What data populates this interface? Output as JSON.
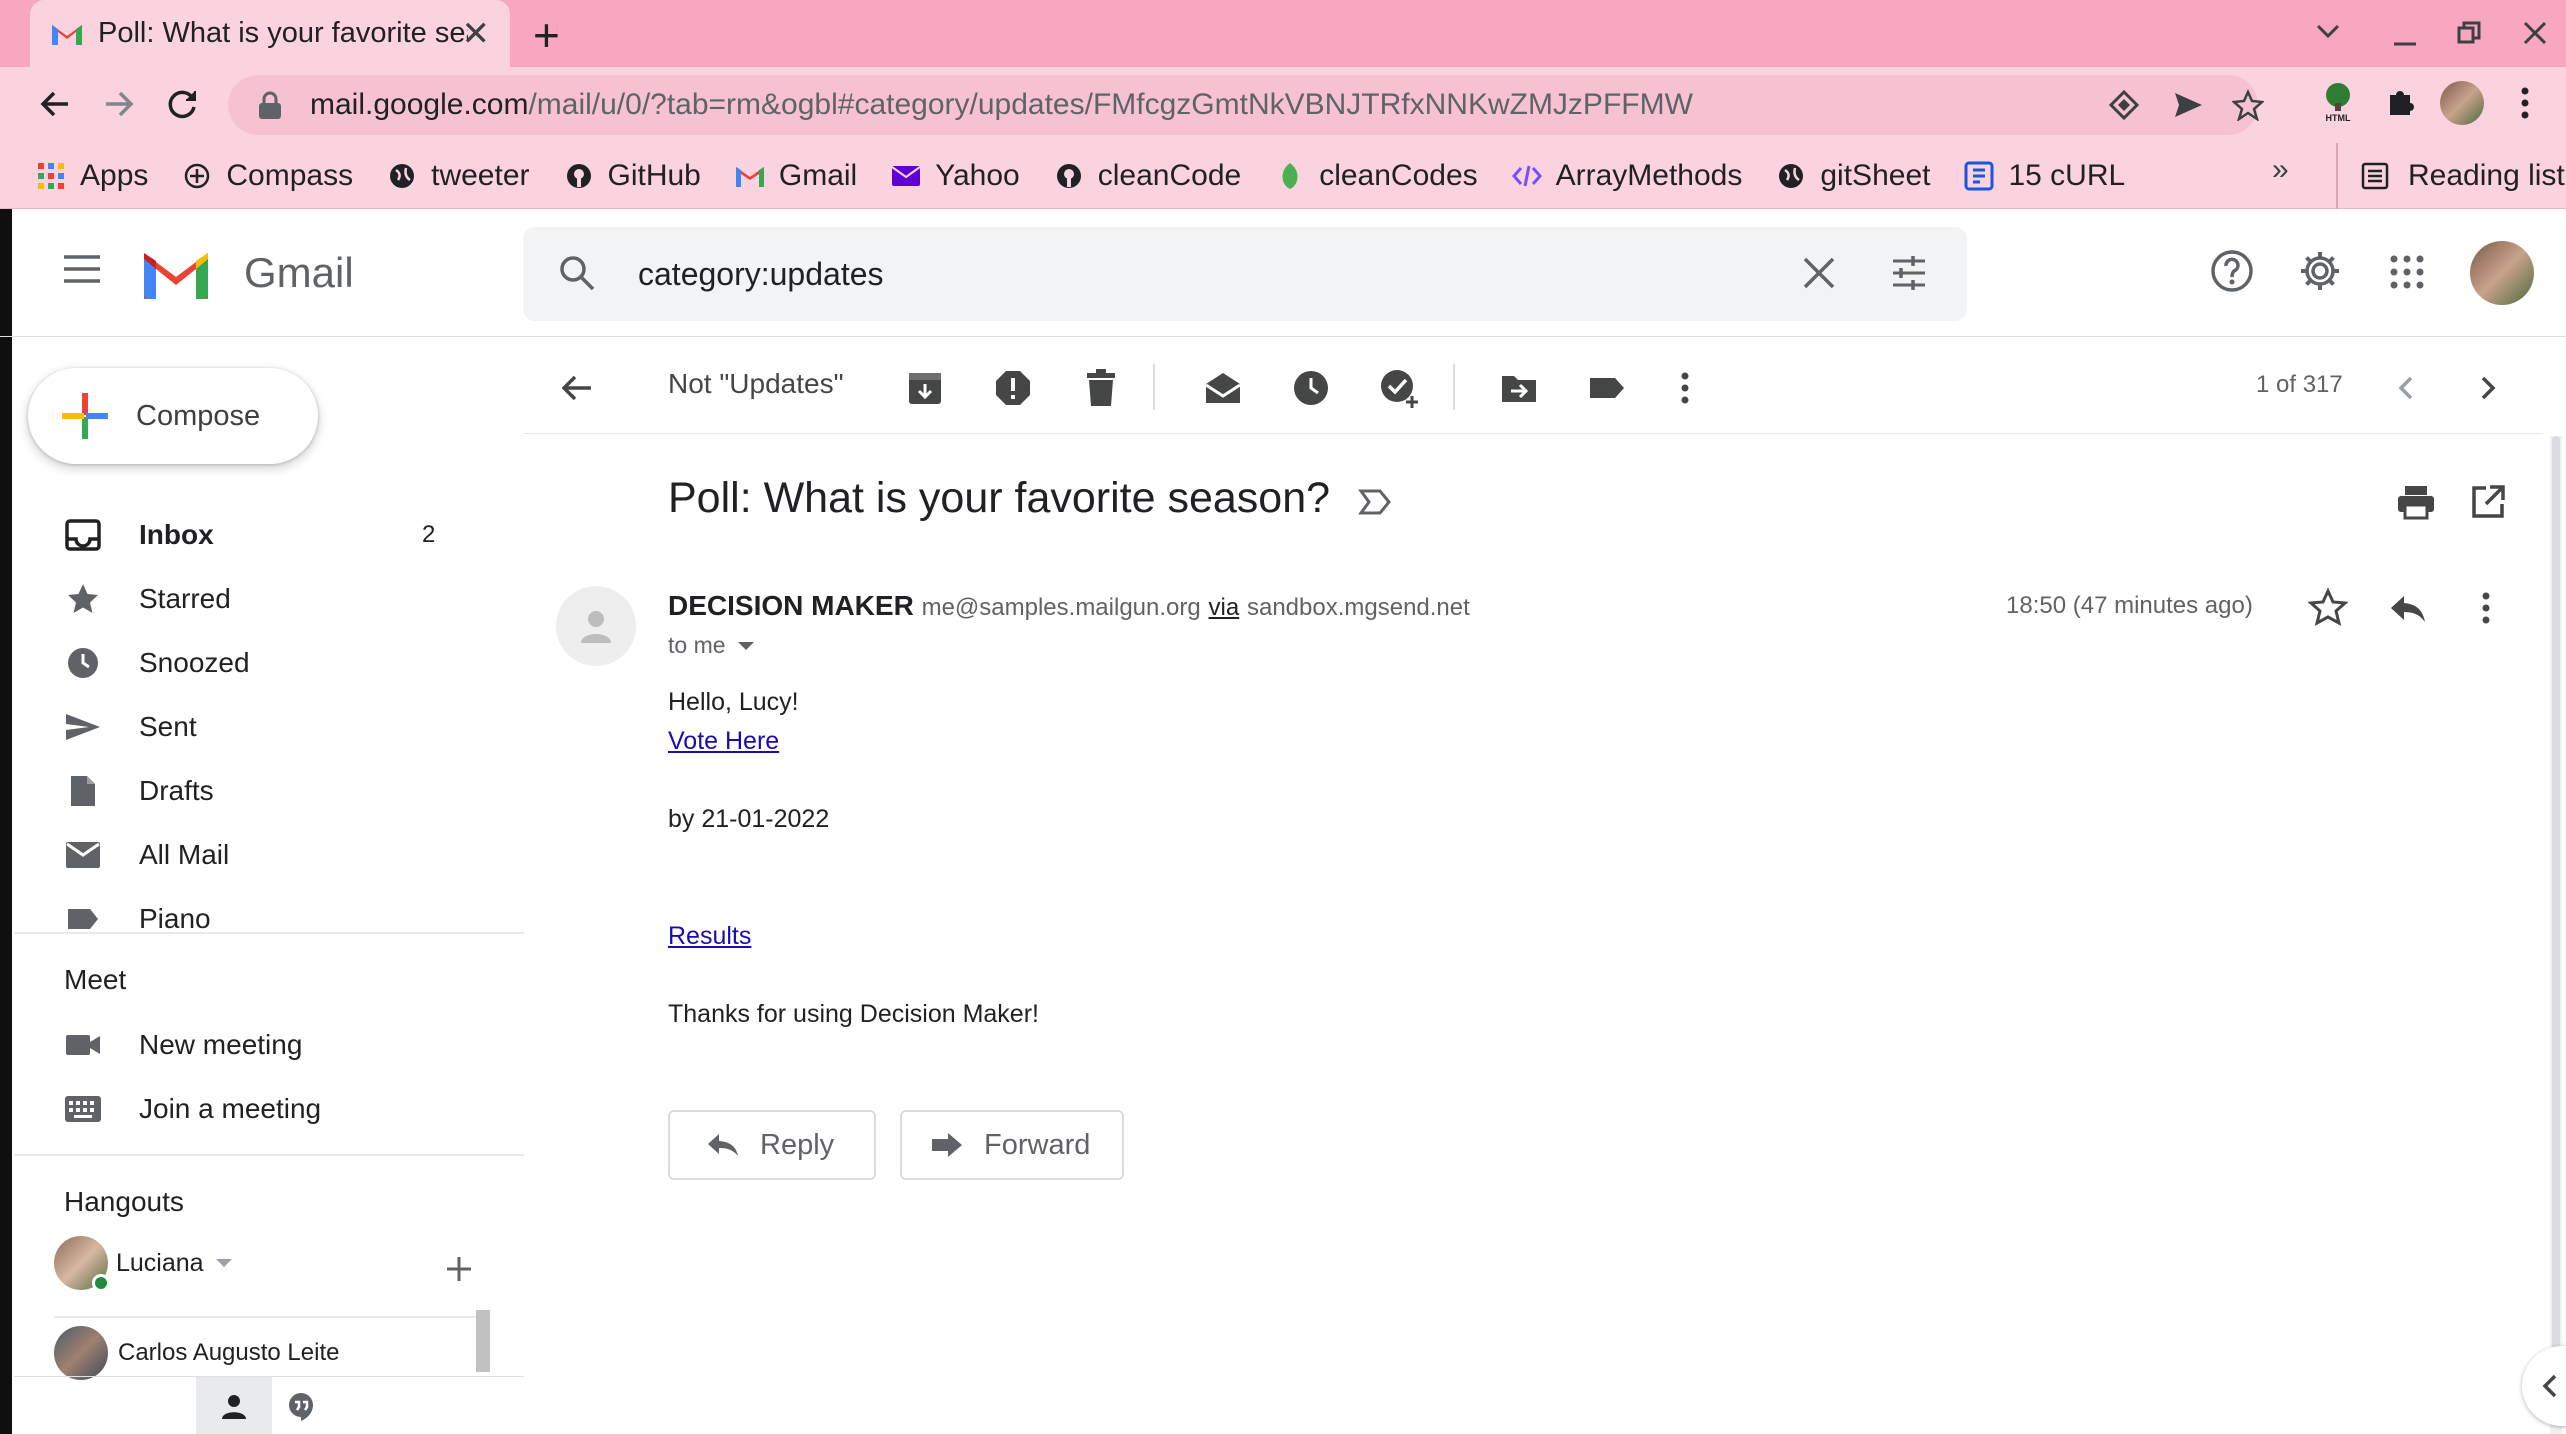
{
  "browser": {
    "tab_title": "Poll: What is your favorite season? - Gmail",
    "url_host": "mail.google.com",
    "url_path": "/mail/u/0/?tab=rm&ogbl#category/updates/FMfcgzGmtNkVBNJTRfxNNKwZMJzPFFMW",
    "bookmarks": [
      {
        "label": "Apps",
        "icon": "apps-grid-icon"
      },
      {
        "label": "Compass",
        "icon": "compass-icon"
      },
      {
        "label": "tweeter",
        "icon": "globe-icon"
      },
      {
        "label": "GitHub",
        "icon": "github-icon"
      },
      {
        "label": "Gmail",
        "icon": "gmail-icon"
      },
      {
        "label": "Yahoo",
        "icon": "yahoo-mail-icon"
      },
      {
        "label": "cleanCode",
        "icon": "github-icon"
      },
      {
        "label": "cleanCodes",
        "icon": "leaf-icon"
      },
      {
        "label": "ArrayMethods",
        "icon": "code-icon"
      },
      {
        "label": "gitSheet",
        "icon": "globe-icon"
      },
      {
        "label": "15 cURL",
        "icon": "doc-icon"
      }
    ],
    "bookmarks_more": "»",
    "reading_list": "Reading list"
  },
  "gmail": {
    "logo_text": "Gmail",
    "search_value": "category:updates",
    "compose_label": "Compose",
    "nav": [
      {
        "label": "Inbox",
        "count": "2",
        "icon": "inbox-icon",
        "bold": true
      },
      {
        "label": "Starred",
        "count": "",
        "icon": "star-icon"
      },
      {
        "label": "Snoozed",
        "count": "",
        "icon": "clock-icon"
      },
      {
        "label": "Sent",
        "count": "",
        "icon": "send-icon"
      },
      {
        "label": "Drafts",
        "count": "",
        "icon": "draft-icon"
      },
      {
        "label": "All Mail",
        "count": "",
        "icon": "mail-icon"
      },
      {
        "label": "Piano",
        "count": "",
        "icon": "label-icon"
      }
    ],
    "meet": {
      "title": "Meet",
      "items": [
        {
          "label": "New meeting",
          "icon": "video-icon"
        },
        {
          "label": "Join a meeting",
          "icon": "keyboard-icon"
        }
      ]
    },
    "hangouts": {
      "title": "Hangouts",
      "me": "Luciana",
      "contact": "Carlos Augusto Leite"
    },
    "toolbar": {
      "not_updates": "Not \"Updates\"",
      "pager": "1 of 317"
    },
    "message": {
      "subject": "Poll: What is your favorite season?",
      "sender_name": "DECISION MAKER",
      "sender_email": "me@samples.mailgun.org",
      "via": "via",
      "via_domain": "sandbox.mgsend.net",
      "to": "to me",
      "time": "18:50 (47 minutes ago)",
      "greeting": "Hello, Lucy!",
      "vote_link": "Vote Here",
      "deadline": "by 21-01-2022",
      "results_link": "Results",
      "thanks": "Thanks for using Decision Maker!",
      "reply_label": "Reply",
      "forward_label": "Forward"
    }
  }
}
